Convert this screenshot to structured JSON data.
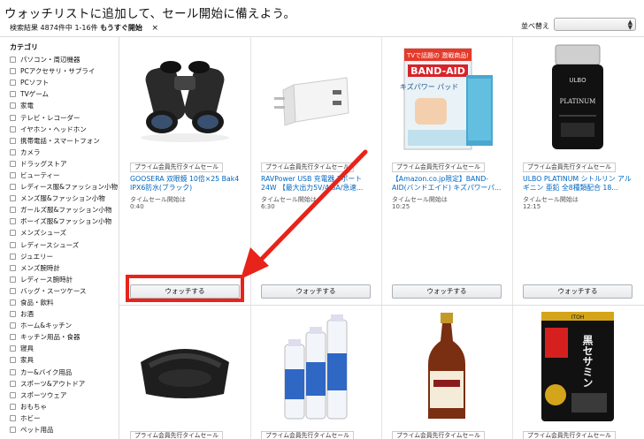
{
  "header": {
    "title": "ウォッチリストに追加して、セール開始に備えよう。",
    "results_prefix": "検索結果 4874件中 1-16件",
    "filter_tag": "もうすぐ開始",
    "filter_clear": "×",
    "sort_label": "並べ替え",
    "sort_value": ""
  },
  "sidebar": {
    "title": "カテゴリ",
    "items": [
      "パソコン・周辺機器",
      "PCアクセサリ・サプライ",
      "PCソフト",
      "TVゲーム",
      "家電",
      "テレビ・レコーダー",
      "イヤホン・ヘッドホン",
      "携帯電話・スマートフォン",
      "カメラ",
      "ドラッグストア",
      "ビューティー",
      "レディース服&ファッション小物",
      "メンズ服&ファッション小物",
      "ガールズ服&ファッション小物",
      "ボーイズ服&ファッション小物",
      "メンズシューズ",
      "レディースシューズ",
      "ジュエリー",
      "メンズ腕時計",
      "レディース腕時計",
      "バッグ・スーツケース",
      "食品・飲料",
      "お酒",
      "ホーム&キッチン",
      "キッチン用品・食器",
      "寝具",
      "家具",
      "カー&バイク用品",
      "スポーツ&アウトドア",
      "スポーツウェア",
      "おもちゃ",
      "ホビー",
      "ペット用品"
    ]
  },
  "products": [
    {
      "badge": "プライム会員先行タイムセール",
      "name": "GOOSERA 双眼鏡 10倍×25 Bak4 IPX6防水(ブラック)",
      "sale_label": "タイムセール開始は",
      "sale_time": "0:40",
      "button": "ウォッチする",
      "image": "binoculars"
    },
    {
      "badge": "プライム会員先行タイムセール",
      "name": "RAVPower USB 充電器 2ポート 24W 【最大出力5V/4.8A/急速...",
      "sale_label": "タイムセール開始は",
      "sale_time": "6:30",
      "button": "ウォッチする",
      "image": "usb-charger"
    },
    {
      "badge": "プライム会員先行タイムセール",
      "name": "【Amazon.co.jp限定】BAND-AID(バンドエイド) キズパワーパ...",
      "sale_label": "タイムセール開始は",
      "sale_time": "10:25",
      "button": "ウォッチする",
      "image": "band-aid-box"
    },
    {
      "badge": "プライム会員先行タイムセール",
      "name": "ULBO PLATINUM シトルリン アルギニン 亜鉛 全8種類配合 18...",
      "sale_label": "タイムセール開始は",
      "sale_time": "12:15",
      "button": "ウォッチする",
      "image": "supplement-bottle"
    },
    {
      "badge": "プライム会員先行タイムセール",
      "image": "seat-cushion"
    },
    {
      "badge": "プライム会員先行タイムセール",
      "image": "spray-cans"
    },
    {
      "badge": "プライム会員先行タイムセール",
      "image": "vinegar-bottle"
    },
    {
      "badge": "プライム会員先行タイムセール",
      "image": "sesamin-pack"
    }
  ],
  "product_images": {
    "band_aid_banner": "TVで話題の 激戦商品!",
    "band_aid_logo": "BAND-AID",
    "band_aid_sub": "キズパワー パッド",
    "ulbo_brand": "ULBO",
    "ulbo_line": "PLATINUM",
    "sesamin_text": "黒セサミン",
    "sesamin_brand": "ITOH"
  },
  "colors": {
    "link": "#0066c0",
    "highlight": "#e8231a",
    "arrow": "#e8231a"
  }
}
